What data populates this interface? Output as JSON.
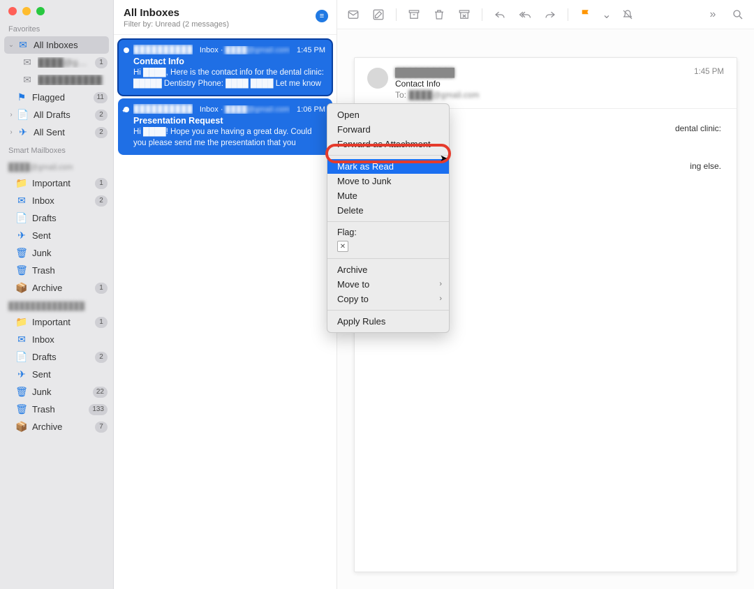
{
  "sidebar": {
    "favorites_label": "Favorites",
    "smart_label": "Smart Mailboxes",
    "all_inboxes": "All Inboxes",
    "account1_short": "████@g…",
    "account1_badge": "1",
    "account2_short": "██████████",
    "flagged": "Flagged",
    "flagged_badge": "11",
    "all_drafts": "All Drafts",
    "all_drafts_badge": "2",
    "all_sent": "All Sent",
    "all_sent_badge": "2",
    "account1_header": "████@gmail.com",
    "account2_header": "██████████████",
    "boxes": {
      "important": "Important",
      "inbox": "Inbox",
      "drafts": "Drafts",
      "sent": "Sent",
      "junk": "Junk",
      "trash": "Trash",
      "archive": "Archive"
    },
    "acc1": {
      "important": "1",
      "inbox": "2",
      "archive": "1"
    },
    "acc2": {
      "important": "1",
      "drafts": "2",
      "junk": "22",
      "trash": "133",
      "archive": "7"
    }
  },
  "list": {
    "title": "All Inboxes",
    "filter": "Filter by: Unread (2 messages)",
    "msgs": [
      {
        "from": "██████████",
        "meta_prefix": "Inbox · ",
        "meta_email": "████@gmail.com",
        "time": "1:45 PM",
        "subject": "Contact Info",
        "preview": "Hi ████, Here is the contact info for the dental clinic: █████ Dentistry Phone: ████ ████ Let me know if you need anyt…"
      },
      {
        "from": "██████████",
        "meta_prefix": "Inbox · ",
        "meta_email": "████@gmail.com",
        "time": "1:06 PM",
        "subject": "Presentation Request",
        "preview": "Hi ████! Hope you are having a great day. Could you please send me the presentation that you mentioned today? I would l…"
      }
    ]
  },
  "reader": {
    "from": "██████████",
    "subject": "Contact Info",
    "to_label": "To:",
    "to_value": "████@gmail.com",
    "time": "1:45 PM",
    "body_frag1": "dental clinic:",
    "body_frag2": "ing else."
  },
  "ctx": {
    "open": "Open",
    "forward": "Forward",
    "forward_att": "Forward as Attachment",
    "mark_read": "Mark as Read",
    "move_junk": "Move to Junk",
    "mute": "Mute",
    "delete": "Delete",
    "flag_label": "Flag:",
    "archive": "Archive",
    "move_to": "Move to",
    "copy_to": "Copy to",
    "apply_rules": "Apply Rules"
  },
  "flag_colors": [
    "#ff9500",
    "#ff3b30",
    "#af52de",
    "#007aff",
    "#ffcc00",
    "#34c759",
    "#8e8e93"
  ]
}
